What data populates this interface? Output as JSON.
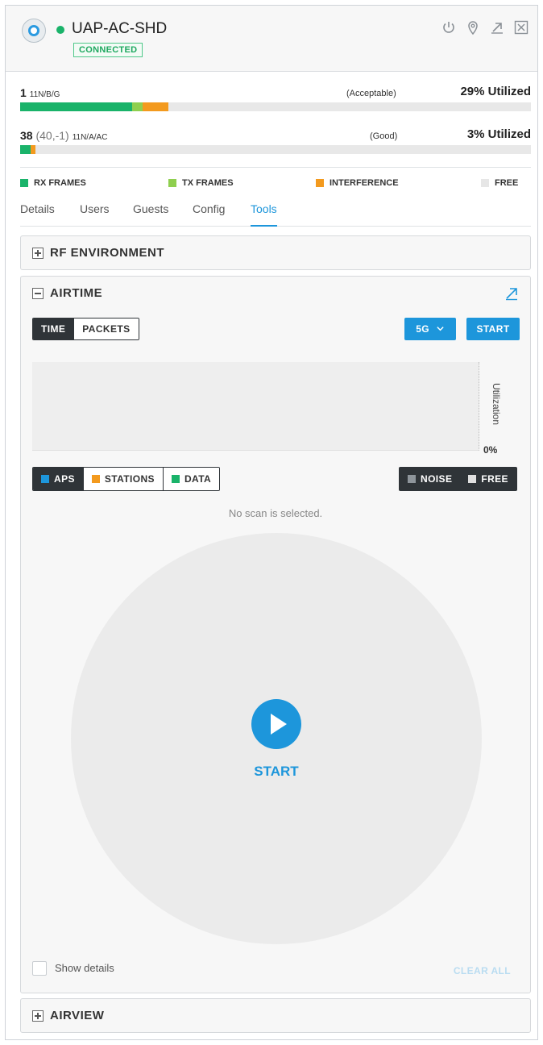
{
  "device": {
    "name": "UAP-AC-SHD",
    "status_badge": "CONNECTED",
    "colors": {
      "status": "#1ab36a",
      "accent": "#1d96db"
    }
  },
  "header_icons": [
    "power-icon",
    "locate-icon",
    "popout-icon",
    "close-icon"
  ],
  "radios": [
    {
      "channel": "1",
      "channel_detail": "",
      "mode": "11N/B/G",
      "quality": "(Acceptable)",
      "utilization": "29% Utilized",
      "bar": {
        "rx": 0.22,
        "tx": 0.02,
        "interference": 0.05
      }
    },
    {
      "channel": "38",
      "channel_detail": "(40,-1)",
      "mode": "11N/A/AC",
      "quality": "(Good)",
      "utilization": "3% Utilized",
      "bar": {
        "rx": 0.02,
        "tx": 0.0,
        "interference": 0.01
      }
    }
  ],
  "legend": {
    "rx": "RX FRAMES",
    "tx": "TX FRAMES",
    "interference": "INTERFERENCE",
    "free": "FREE",
    "colors": {
      "rx": "#1ab36a",
      "tx": "#8fcf4f",
      "interference": "#f39a1e",
      "free": "#e6e6e6"
    }
  },
  "tabs": [
    "Details",
    "Users",
    "Guests",
    "Config",
    "Tools"
  ],
  "active_tab": "Tools",
  "sections": {
    "rf_environment": "RF ENVIRONMENT",
    "airtime": "AIRTIME",
    "airview": "AIRVIEW"
  },
  "airtime": {
    "mode_options": [
      "TIME",
      "PACKETS"
    ],
    "selected_mode": "TIME",
    "band": "5G",
    "start_button": "START",
    "y_axis_label": "Utilization",
    "y_axis_zero": "0%",
    "filters_left": [
      "APS",
      "STATIONS",
      "DATA"
    ],
    "filters_right": [
      "NOISE",
      "FREE"
    ],
    "filter_colors": {
      "aps": "#1d96db",
      "stations": "#f39a1e",
      "data": "#1ab36a",
      "noise": "#8e959b",
      "free": "#e0e0e0"
    },
    "empty_message": "No scan is selected.",
    "center_start": "START",
    "show_details": "Show details",
    "clear_all": "CLEAR ALL"
  }
}
